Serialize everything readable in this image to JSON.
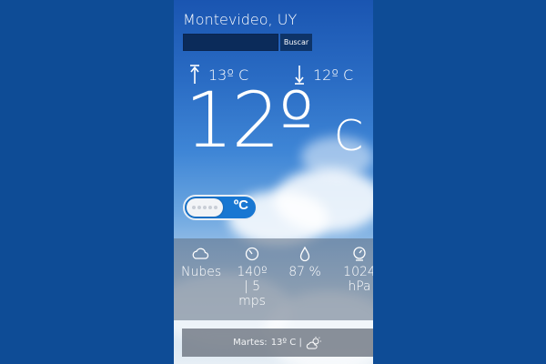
{
  "location": "Montevideo, UY",
  "search": {
    "button_label": "Buscar",
    "input_value": ""
  },
  "temps": {
    "max": "13º C",
    "min": "12º C",
    "current_value": "12º",
    "current_unit": "C"
  },
  "unit_toggle": {
    "label": "ºC"
  },
  "details": {
    "condition": "Nubes",
    "wind_dir": "140º",
    "wind_sep": "| 5",
    "wind_unit": "mps",
    "humidity": "87 %",
    "pressure_value": "1024",
    "pressure_unit": "hPa"
  },
  "forecast": {
    "day": "Martes:",
    "temp": "13º C |"
  },
  "icons": {
    "max": "arrow-up-icon",
    "min": "arrow-down-icon",
    "condition": "cloud-icon",
    "wind": "compass-icon",
    "humidity": "drop-icon",
    "pressure": "gauge-icon",
    "forecast": "sun-cloud-icon"
  }
}
